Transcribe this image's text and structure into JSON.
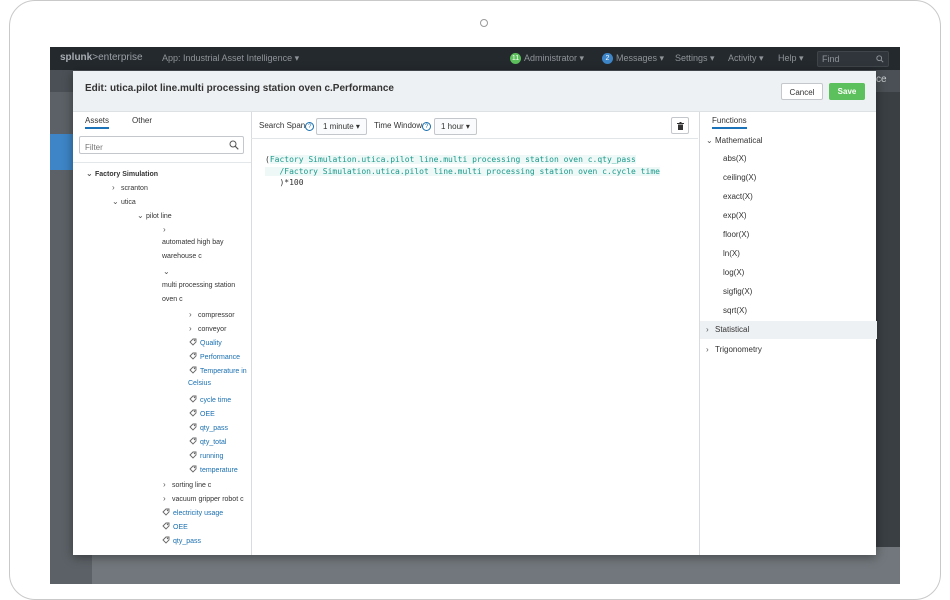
{
  "topbar": {
    "logo_main": "splunk",
    "logo_suffix": ">enterprise",
    "app": "App: Industrial Asset Intelligence ▾",
    "admin_badge": "11",
    "admin": "Administrator ▾",
    "messages_badge": "2",
    "messages": "Messages ▾",
    "settings": "Settings ▾",
    "activity": "Activity ▾",
    "help": "Help ▾",
    "find": "Find",
    "bg_text": "ce"
  },
  "modal": {
    "title": "Edit: utica.pilot line.multi processing station oven c.Performance",
    "cancel_label": "Cancel",
    "save_label": "Save"
  },
  "left": {
    "tabs": [
      "Assets",
      "Other"
    ],
    "filter_placeholder": "Filter",
    "tree": {
      "root": "Factory Simulation",
      "scranton": "scranton",
      "utica": "utica",
      "pilot_line": "pilot line",
      "ahbw_1": "automated high bay",
      "ahbw_2": "warehouse c",
      "mps_1": "multi processing station",
      "mps_2": "oven c",
      "compressor": "compressor",
      "conveyor": "conveyor",
      "metrics": [
        "Quality",
        "Performance",
        "Temperature in",
        "Celsius",
        "cycle time",
        "OEE",
        "qty_pass",
        "qty_total",
        "running",
        "temperature"
      ],
      "sorting_line": "sorting line c",
      "vacuum": "vacuum gripper robot c",
      "pl_metrics": [
        "electricity usage",
        "OEE",
        "qty_pass"
      ]
    }
  },
  "mid": {
    "search_span_label": "Search Span",
    "search_span_value": "1 minute ▾",
    "time_window_label": "Time Window",
    "time_window_value": "1 hour ▾",
    "help_glyph": "?",
    "code_lines": [
      "(",
      "Factory Simulation.utica.pilot line.multi processing station oven c.qty_pass",
      "   /",
      "Factory Simulation.utica.pilot line.multi processing station oven c.cycle time",
      "   )*100"
    ]
  },
  "right": {
    "tab": "Functions",
    "mathematical": "Mathematical",
    "functions": [
      "abs(X)",
      "ceiling(X)",
      "exact(X)",
      "exp(X)",
      "floor(X)",
      "ln(X)",
      "log(X)",
      "sigfig(X)",
      "sqrt(X)"
    ],
    "statistical": "Statistical",
    "trigonometry": "Trigonometry"
  }
}
